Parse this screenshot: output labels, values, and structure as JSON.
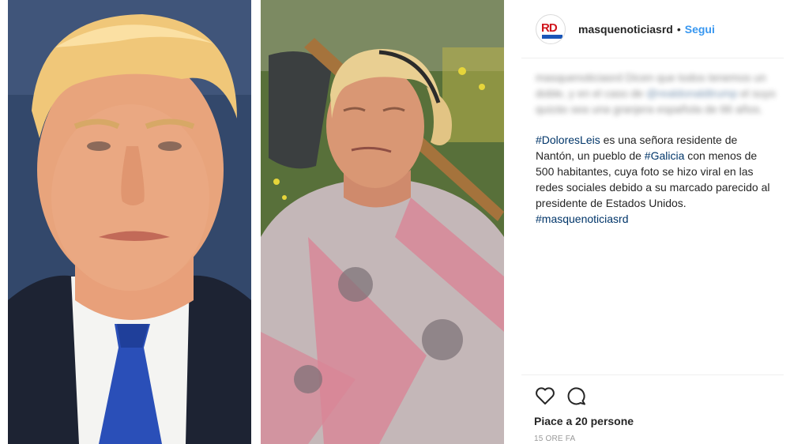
{
  "post": {
    "username": "masquenoticiasrd",
    "separator": "•",
    "follow_label": "Segui",
    "caption_blurred": {
      "text_a": "masquenoticiasrd Dicen que todos tenemos un doble, y en el caso de ",
      "mention": "@realdonaldtrump",
      "text_b": " el suyo quizás sea una granjera española de 66 años."
    },
    "caption": {
      "tag1": "#DoloresLeis",
      "text1": " es una señora residente de Nantón, un pueblo de ",
      "tag2": "#Galicia",
      "text2": " con menos de 500 habitantes, cuya foto se hizo viral en las redes sociales debido a su marcado parecido al presidente de Estados Unidos.",
      "tag3": "#masquenoticiasrd"
    },
    "likes_label": "Piace a 20 persone",
    "timestamp": "15 ORE FA"
  },
  "icons": {
    "like": "heart-icon",
    "comment": "comment-icon"
  },
  "colors": {
    "link": "#003569",
    "follow": "#3897f0",
    "text": "#262626",
    "muted": "#999999",
    "divider": "#efefef",
    "avatar_red": "#d0151c",
    "avatar_blue": "#1a56b8"
  }
}
